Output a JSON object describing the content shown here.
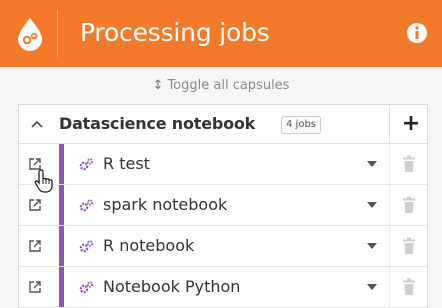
{
  "header": {
    "title": "Processing jobs",
    "background": "#f37a2a",
    "logo_icon": "droplet-gears-icon",
    "info_icon": "info-icon"
  },
  "toggle": {
    "label": "Toggle all capsules",
    "icon": "vertical-arrows-icon"
  },
  "group": {
    "title": "Datascience notebook",
    "badge": "4 jobs",
    "add_label": "+",
    "accent_color": "#8e55b6",
    "jobs": [
      {
        "name": "R test"
      },
      {
        "name": "spark notebook"
      },
      {
        "name": "R notebook"
      },
      {
        "name": "Notebook Python"
      }
    ]
  }
}
